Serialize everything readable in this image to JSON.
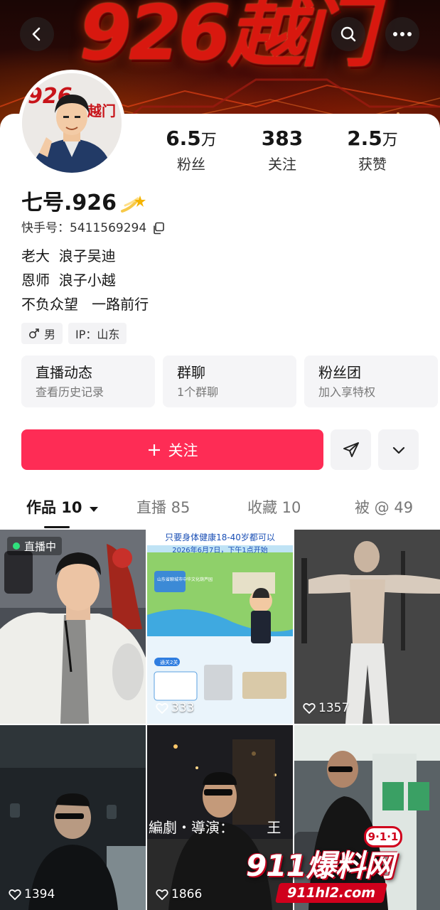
{
  "banner": {
    "title": "926越门"
  },
  "stats": [
    {
      "value": "6.5",
      "unit": "万",
      "label": "粉丝"
    },
    {
      "value": "383",
      "unit": "",
      "label": "关注"
    },
    {
      "value": "2.5",
      "unit": "万",
      "label": "获赞"
    }
  ],
  "profile": {
    "nickname": "七号.926",
    "account": "快手号：5411569294",
    "bio": [
      "老大  浪子吴迪",
      "恩师  浪子小越",
      "不负众望   一路前行"
    ],
    "gender": "男",
    "ip": "IP：山东",
    "avatar_text": "926越门"
  },
  "features": [
    {
      "title": "直播动态",
      "sub": "查看历史记录"
    },
    {
      "title": "群聊",
      "sub": "1个群聊"
    },
    {
      "title": "粉丝团",
      "sub": "加入享特权"
    }
  ],
  "actions": {
    "follow": "关注"
  },
  "tabs": [
    {
      "label": "作品 10",
      "active": true
    },
    {
      "label": "直播 85",
      "active": false
    },
    {
      "label": "收藏 10",
      "active": false
    },
    {
      "label": "被 @ 49",
      "active": false
    }
  ],
  "grid": {
    "live_label": "直播中",
    "items": [
      {
        "likes": ""
      },
      {
        "likes": "333"
      },
      {
        "likes": "1357"
      },
      {
        "likes": "1394"
      },
      {
        "likes": "1866"
      },
      {
        "likes": ""
      }
    ],
    "poster_head": "只要身体健康18-40岁都可以",
    "poster_date": "2026年6月7日，下午1点开始",
    "poster_sign": "山东省聊城市中华文化葫芦园",
    "poster_stage": "通关2关",
    "caption": "編劇・導演：",
    "caption_extra": "王"
  },
  "watermark": {
    "main": "911爆料网",
    "badge": "9·1·1",
    "url": "911hl2.com"
  },
  "colors": {
    "accent": "#fe2c55",
    "banner_red": "#d8180f",
    "live": "#2fe07c"
  }
}
